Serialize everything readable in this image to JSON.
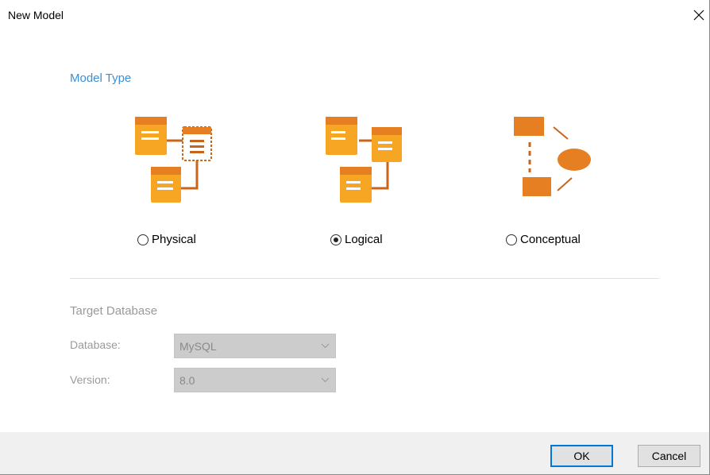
{
  "window": {
    "title": "New Model"
  },
  "model_type": {
    "heading": "Model Type",
    "options": [
      {
        "label": "Physical",
        "selected": false,
        "icon": "physical-model-icon"
      },
      {
        "label": "Logical",
        "selected": true,
        "icon": "logical-model-icon"
      },
      {
        "label": "Conceptual",
        "selected": false,
        "icon": "conceptual-model-icon"
      }
    ]
  },
  "target_database": {
    "heading": "Target Database",
    "database_label": "Database:",
    "database_value": "MySQL",
    "version_label": "Version:",
    "version_value": "8.0",
    "enabled": false
  },
  "buttons": {
    "ok": "OK",
    "cancel": "Cancel"
  },
  "colors": {
    "accent": "#3b8fd6",
    "icon_orange": "#f6a623",
    "icon_dark_orange": "#e67e22",
    "disabled_text": "#9a9a9a"
  }
}
